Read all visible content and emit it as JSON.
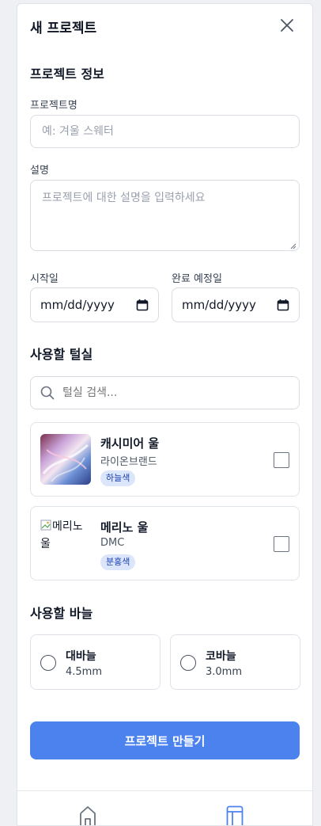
{
  "dialog": {
    "title": "새 프로젝트"
  },
  "project_info": {
    "heading": "프로젝트 정보",
    "name_label": "프로젝트명",
    "name_placeholder": "예: 겨울 스웨터",
    "desc_label": "설명",
    "desc_placeholder": "프로젝트에 대한 설명을 입력하세요",
    "start_label": "시작일",
    "start_value": "mm/dd/yyyy",
    "end_label": "완료 예정일",
    "end_value": "mm/dd/yyyy"
  },
  "yarns": {
    "heading": "사용할 털실",
    "search_placeholder": "털실 검색...",
    "items": [
      {
        "name": "캐시미어 울",
        "brand": "라이온브랜드",
        "color": "하늘색",
        "checked": false
      },
      {
        "name": "메리노 울",
        "brand": "DMC",
        "color": "분홍색",
        "image_alt": "메리노 울",
        "checked": false
      }
    ]
  },
  "needles": {
    "heading": "사용할 바늘",
    "items": [
      {
        "name": "대바늘",
        "size": "4.5mm",
        "selected": false
      },
      {
        "name": "코바늘",
        "size": "3.0mm",
        "selected": false
      }
    ]
  },
  "submit_label": "프로젝트 만들기",
  "icons": {
    "close": "close-icon",
    "search": "search-icon",
    "calendar": "calendar-icon",
    "home": "home-icon",
    "projects": "layout-icon"
  },
  "colors": {
    "accent": "#4c82ee",
    "chip_bg": "#dbe6fb",
    "chip_text": "#1e40af"
  }
}
